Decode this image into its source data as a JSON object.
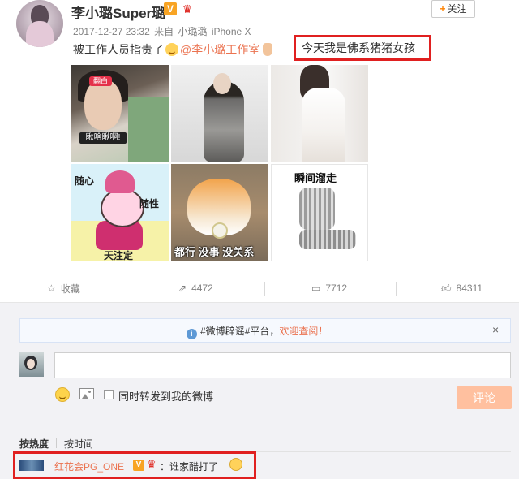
{
  "post": {
    "username": "李小璐Super璐",
    "verified_badge": "V",
    "follow_label": "关注",
    "follow_plus": "+",
    "timestamp": "2017-12-27 23:32",
    "source_prefix": "来自",
    "source_name": "小璐璐",
    "device": "iPhone X",
    "text_before": "被工作人员指责了",
    "mention": "@李小璐工作室",
    "highlight_text": "今天我是佛系猪猪女孩",
    "accent_color": "#eb7350",
    "highlight_box_color": "#e02020"
  },
  "images": {
    "img1_tag": "翻白",
    "img1_caption": "瞅啥瞅啊!",
    "img4_left_top": "随心",
    "img4_right": "随性",
    "img4_bottom": "天注定",
    "img5_caption": "都行 没事 没关系",
    "img6_title": "瞬间溜走"
  },
  "actions": {
    "favorite_label": "收藏",
    "repost_count": "4472",
    "comment_count": "7712",
    "like_count": "84311"
  },
  "comments": {
    "notice_text": "#微博辟谣#平台，",
    "notice_link": "欢迎查阅！",
    "close_symbol": "×",
    "input_placeholder": "",
    "repost_checkbox_label": "同时转发到我的微博",
    "submit_label": "评论",
    "sort_hot": "按热度",
    "sort_time": "按时间",
    "first_comment_user": "红花会PG_ONE",
    "first_comment_badge": "V",
    "first_comment_text": "：谁家醋打了"
  }
}
